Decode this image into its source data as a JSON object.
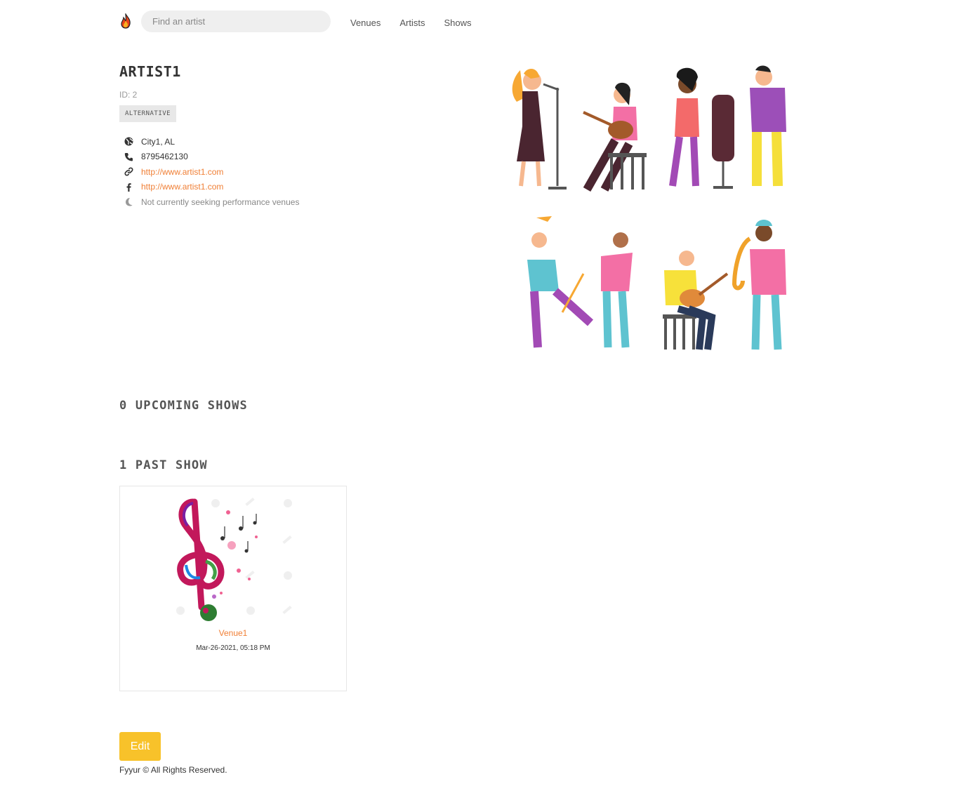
{
  "nav": {
    "search_placeholder": "Find an artist",
    "links": [
      "Venues",
      "Artists",
      "Shows"
    ]
  },
  "artist": {
    "name": "ARTIST1",
    "id_text": "ID: 2",
    "genre": "ALTERNATIVE",
    "location": "City1, AL",
    "phone": "8795462130",
    "website": "http://www.artist1.com",
    "facebook": "http://www.artist1.com",
    "seeking": "Not currently seeking performance venues"
  },
  "upcoming_title": "0 UPCOMING SHOWS",
  "past_title": "1 PAST SHOW",
  "past_shows": [
    {
      "venue": "Venue1",
      "date": "Mar-26-2021, 05:18 PM"
    }
  ],
  "edit_label": "Edit",
  "footer": "Fyyur © All Rights Reserved.",
  "colors": {
    "accent": "#f07f35",
    "button": "#f8c22a"
  }
}
